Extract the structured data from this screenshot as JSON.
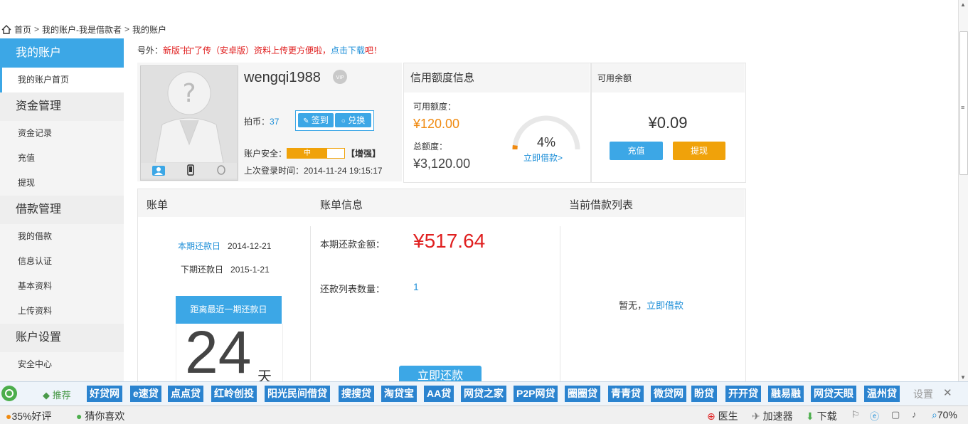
{
  "breadcrumb": {
    "home": "首页",
    "sep": ">",
    "item1": "我的账户-我是借款者",
    "item2": "我的账户"
  },
  "sidebar": {
    "header": "我的账户",
    "items": [
      {
        "type": "item",
        "label": "我的账户首页",
        "active": true
      },
      {
        "type": "section",
        "label": "资金管理"
      },
      {
        "type": "item",
        "label": "资金记录"
      },
      {
        "type": "item",
        "label": "充值"
      },
      {
        "type": "item",
        "label": "提现"
      },
      {
        "type": "section",
        "label": "借款管理"
      },
      {
        "type": "item",
        "label": "我的借款"
      },
      {
        "type": "item",
        "label": "信息认证"
      },
      {
        "type": "item",
        "label": "基本资料"
      },
      {
        "type": "item",
        "label": "上传资料"
      },
      {
        "type": "section",
        "label": "账户设置"
      },
      {
        "type": "item",
        "label": "安全中心"
      }
    ]
  },
  "notice": {
    "prefix": "号外：",
    "red": "新版”拍“了传（安卓版）资料上传更方便啦，",
    "link": "点击下载",
    "suffix": "吧！"
  },
  "profile": {
    "username": "wengqi1988",
    "vip": "VIP",
    "coins_label": "拍币：",
    "coins": "37",
    "sign_btn": "签到",
    "exchange_btn": "兑换",
    "security_label": "账户安全：",
    "security_level": "中",
    "security_level_fraction": 0.7,
    "security_action": "【增强】",
    "last_login": "上次登录时间：2014-11-24 19:15:17"
  },
  "credit": {
    "title": "信用额度信息",
    "available_label": "可用额度：",
    "available": "¥120.00",
    "total_label": "总额度：",
    "total": "¥3,120.00",
    "percent": "4%",
    "percent_value": 0.04,
    "borrow_link": "立即借款>"
  },
  "balance": {
    "title": "可用余额",
    "amount": "¥0.09",
    "recharge": "充值",
    "withdraw": "提现"
  },
  "bills": {
    "col1": "账单",
    "col2": "账单信息",
    "col3": "当前借款列表",
    "this_due_label": "本期还款日",
    "this_due": "2014-12-21",
    "next_due_label": "下期还款日",
    "next_due": "2015-1-21",
    "countdown_label": "距离最近一期还款日",
    "countdown": "24",
    "countdown_unit": "天",
    "repay_label": "本期还款金额：",
    "repay_amount": "¥517.64",
    "count_label": "还款列表数量：",
    "count": "1",
    "repay_btn": "立即还款",
    "none_text": "暂无，",
    "none_link": "立即借款"
  },
  "browser": {
    "recommend": "推荐",
    "tags": [
      "好贷网",
      "e速贷",
      "点点贷",
      "红岭创投",
      "阳光民间借贷",
      "搜搜贷",
      "淘贷宝",
      "AA贷",
      "网贷之家",
      "P2P网贷",
      "圈圈贷",
      "青青贷",
      "微贷网",
      "盼贷",
      "开开贷",
      "融易融",
      "网贷天眼",
      "温州贷"
    ],
    "settings": "设置",
    "close": "✕",
    "status_left1": "35%好评",
    "status_left2": "猜你喜欢",
    "doctor": "医生",
    "accelerator": "加速器",
    "download": "下载",
    "zoom": "70%"
  }
}
